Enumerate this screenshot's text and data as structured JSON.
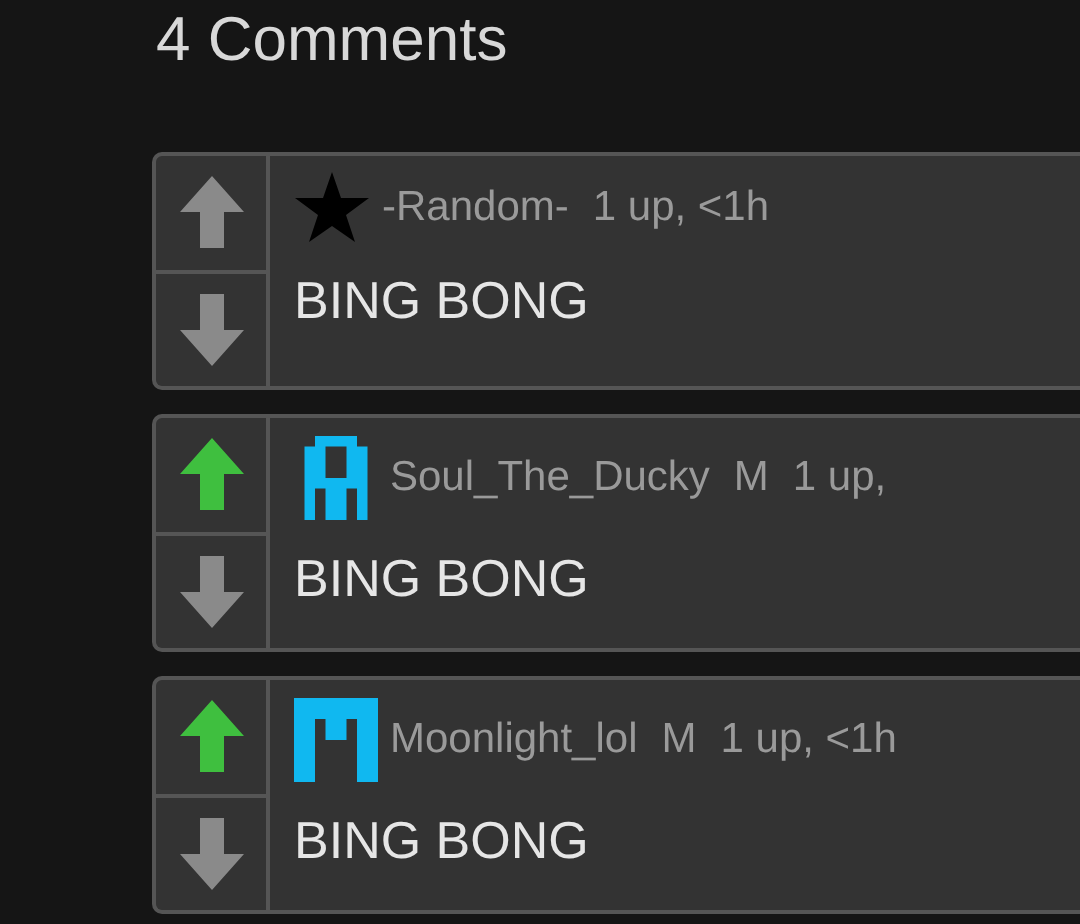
{
  "heading": "4 Comments",
  "comments": [
    {
      "avatar": {
        "kind": "star"
      },
      "user": "-Random-",
      "meta": "1 up, <1h",
      "upvote_active": false,
      "text": "BING BONG"
    },
    {
      "avatar": {
        "kind": "pixel-a"
      },
      "user": "Soul_The_Ducky",
      "mod_badge": "M",
      "meta": "1 up,",
      "upvote_active": true,
      "text": "BING BONG"
    },
    {
      "avatar": {
        "kind": "pixel-m"
      },
      "user": "Moonlight_lol",
      "mod_badge": "M",
      "meta": "1 up, <1h",
      "upvote_active": true,
      "text": "BING BONG"
    }
  ]
}
